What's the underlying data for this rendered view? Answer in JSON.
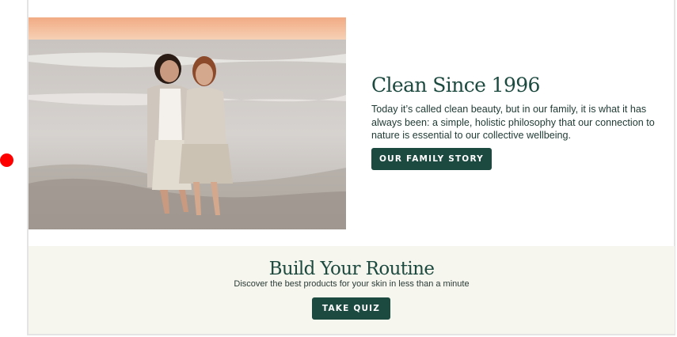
{
  "hero": {
    "image_alt": "Two women standing together in shallow ocean water at sunset",
    "title": "Clean Since 1996",
    "body": "Today it’s called clean beauty, but in our family, it is what it has always been: a simple, holistic philosophy that our connection to nature is essential to our collective wellbeing.",
    "button_label": "OUR FAMILY STORY"
  },
  "routine": {
    "title": "Build Your Routine",
    "subtitle": "Discover the best products for your skin in less than a minute",
    "button_label": "TAKE QUIZ"
  },
  "colors": {
    "brand_green": "#1c4a40",
    "routine_bg": "#f6f6ef",
    "cursor": "#ff0000"
  }
}
